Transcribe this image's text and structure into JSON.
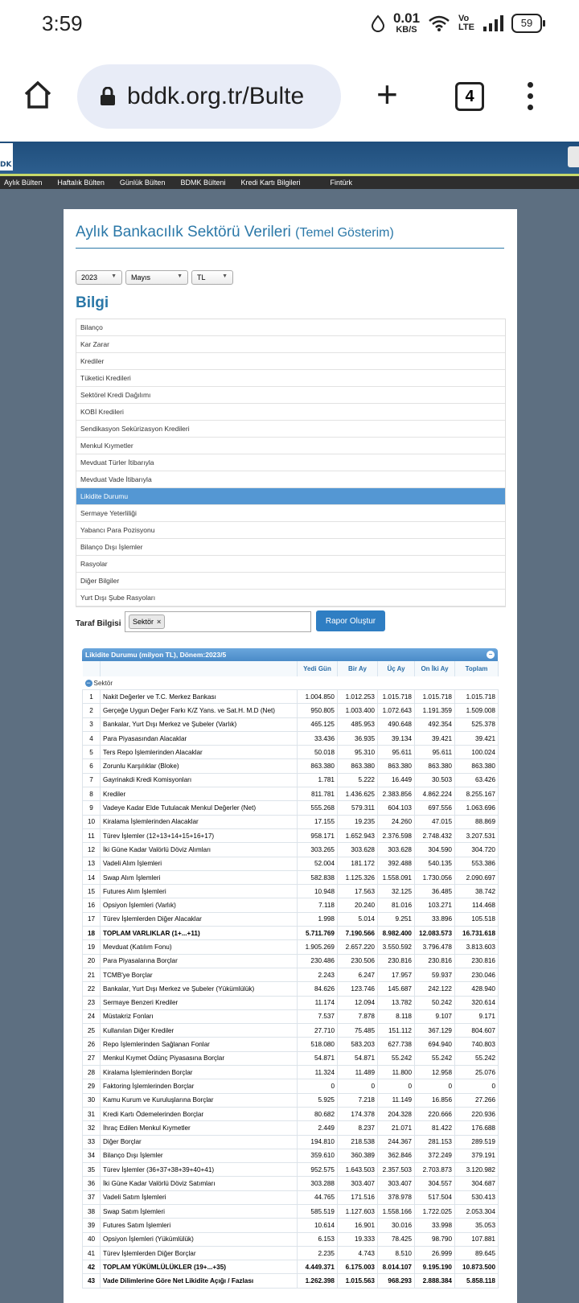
{
  "status_bar": {
    "time": "3:59",
    "net_speed": "0.01",
    "net_unit": "KB/S",
    "volte_top": "Vo",
    "volte_bottom": "LTE",
    "battery": "59"
  },
  "browser": {
    "url": "bddk.org.tr/Bulte",
    "tab_count": "4",
    "plus": "+"
  },
  "site": {
    "logo_text": "DK",
    "nav": [
      "Aylık Bülten",
      "Haftalık Bülten",
      "Günlük Bülten",
      "BDMK Bülteni",
      "Kredi Kartı Bilgileri",
      "Fintürk"
    ],
    "page_title": "Aylık Bankacılık Sektörü Verileri",
    "page_subtitle": "(Temel Gösterim)",
    "selects": {
      "year": "2023",
      "month": "Mayıs",
      "currency": "TL"
    },
    "section_title": "Bilgi",
    "menu": [
      "Bilanço",
      "Kar Zarar",
      "Krediler",
      "Tüketici Kredileri",
      "Sektörel Kredi Dağılımı",
      "KOBİ Kredileri",
      "Sendikasyon Sekürizasyon Kredileri",
      "Menkul Kıymetler",
      "Mevduat Türler İtibarıyla",
      "Mevduat Vade İtibarıyla",
      "Likidite Durumu",
      "Sermaye Yeterliliği",
      "Yabancı Para Pozisyonu",
      "Bilanço Dışı İşlemler",
      "Rasyolar",
      "Diğer Bilgiler",
      "Yurt Dışı Şube Rasyoları"
    ],
    "menu_active_index": 10,
    "taraf_label": "Taraf Bilgisi",
    "tag": "Sektör",
    "tag_remove": "×",
    "report_button": "Rapor Oluştur",
    "table": {
      "title": "Likidite Durumu (milyon TL), Dönem:2023/5",
      "collapse_icon": "−",
      "columns": [
        "Yedi Gün",
        "Bir Ay",
        "Üç Ay",
        "On İki Ay",
        "Toplam"
      ],
      "group": "Sektör",
      "rows": [
        {
          "no": "1",
          "name": "Nakit Değerler ve T.C. Merkez Bankası",
          "v": [
            "1.004.850",
            "1.012.253",
            "1.015.718",
            "1.015.718",
            "1.015.718"
          ]
        },
        {
          "no": "2",
          "name": "Gerçeğe Uygun Değer Farkı K/Z Yans. ve Sat.H. M.D (Net)",
          "v": [
            "950.805",
            "1.003.400",
            "1.072.643",
            "1.191.359",
            "1.509.008"
          ]
        },
        {
          "no": "3",
          "name": "Bankalar, Yurt Dışı Merkez ve Şubeler (Varlık)",
          "v": [
            "465.125",
            "485.953",
            "490.648",
            "492.354",
            "525.378"
          ]
        },
        {
          "no": "4",
          "name": "Para Piyasasından Alacaklar",
          "v": [
            "33.436",
            "36.935",
            "39.134",
            "39.421",
            "39.421"
          ]
        },
        {
          "no": "5",
          "name": "Ters Repo İşlemlerinden Alacaklar",
          "v": [
            "50.018",
            "95.310",
            "95.611",
            "95.611",
            "100.024"
          ]
        },
        {
          "no": "6",
          "name": "Zorunlu Karşılıklar (Bloke)",
          "v": [
            "863.380",
            "863.380",
            "863.380",
            "863.380",
            "863.380"
          ]
        },
        {
          "no": "7",
          "name": "Gayrinakdi Kredi Komisyonları",
          "v": [
            "1.781",
            "5.222",
            "16.449",
            "30.503",
            "63.426"
          ]
        },
        {
          "no": "8",
          "name": "Krediler",
          "v": [
            "811.781",
            "1.436.625",
            "2.383.856",
            "4.862.224",
            "8.255.167"
          ]
        },
        {
          "no": "9",
          "name": "Vadeye Kadar Elde Tutulacak Menkul Değerler (Net)",
          "v": [
            "555.268",
            "579.311",
            "604.103",
            "697.556",
            "1.063.696"
          ]
        },
        {
          "no": "10",
          "name": "Kiralama İşlemlerinden Alacaklar",
          "v": [
            "17.155",
            "19.235",
            "24.260",
            "47.015",
            "88.869"
          ]
        },
        {
          "no": "11",
          "name": "Türev İşlemler (12+13+14+15+16+17)",
          "v": [
            "958.171",
            "1.652.943",
            "2.376.598",
            "2.748.432",
            "3.207.531"
          ]
        },
        {
          "no": "12",
          "name": "İki Güne Kadar Valörlü Döviz Alımları",
          "v": [
            "303.265",
            "303.628",
            "303.628",
            "304.590",
            "304.720"
          ]
        },
        {
          "no": "13",
          "name": "Vadeli Alım İşlemleri",
          "v": [
            "52.004",
            "181.172",
            "392.488",
            "540.135",
            "553.386"
          ]
        },
        {
          "no": "14",
          "name": "Swap Alım İşlemleri",
          "v": [
            "582.838",
            "1.125.326",
            "1.558.091",
            "1.730.056",
            "2.090.697"
          ]
        },
        {
          "no": "15",
          "name": "Futures Alım İşlemleri",
          "v": [
            "10.948",
            "17.563",
            "32.125",
            "36.485",
            "38.742"
          ]
        },
        {
          "no": "16",
          "name": "Opsiyon İşlemleri (Varlık)",
          "v": [
            "7.118",
            "20.240",
            "81.016",
            "103.271",
            "114.468"
          ]
        },
        {
          "no": "17",
          "name": "Türev İşlemlerden Diğer Alacaklar",
          "v": [
            "1.998",
            "5.014",
            "9.251",
            "33.896",
            "105.518"
          ]
        },
        {
          "no": "18",
          "name": "TOPLAM VARLIKLAR (1+...+11)",
          "v": [
            "5.711.769",
            "7.190.566",
            "8.982.400",
            "12.083.573",
            "16.731.618"
          ],
          "bold": true
        },
        {
          "no": "19",
          "name": "Mevduat (Katılım Fonu)",
          "v": [
            "1.905.269",
            "2.657.220",
            "3.550.592",
            "3.796.478",
            "3.813.603"
          ]
        },
        {
          "no": "20",
          "name": "Para Piyasalarına Borçlar",
          "v": [
            "230.486",
            "230.506",
            "230.816",
            "230.816",
            "230.816"
          ]
        },
        {
          "no": "21",
          "name": "TCMB'ye Borçlar",
          "v": [
            "2.243",
            "6.247",
            "17.957",
            "59.937",
            "230.046"
          ]
        },
        {
          "no": "22",
          "name": "Bankalar, Yurt Dışı Merkez ve Şubeler (Yükümlülük)",
          "v": [
            "84.626",
            "123.746",
            "145.687",
            "242.122",
            "428.940"
          ]
        },
        {
          "no": "23",
          "name": "Sermaye Benzeri Krediler",
          "v": [
            "11.174",
            "12.094",
            "13.782",
            "50.242",
            "320.614"
          ]
        },
        {
          "no": "24",
          "name": "Müstakriz Fonları",
          "v": [
            "7.537",
            "7.878",
            "8.118",
            "9.107",
            "9.171"
          ]
        },
        {
          "no": "25",
          "name": "Kullanılan Diğer Krediler",
          "v": [
            "27.710",
            "75.485",
            "151.112",
            "367.129",
            "804.607"
          ]
        },
        {
          "no": "26",
          "name": "Repo İşlemlerinden Sağlanan Fonlar",
          "v": [
            "518.080",
            "583.203",
            "627.738",
            "694.940",
            "740.803"
          ]
        },
        {
          "no": "27",
          "name": "Menkul Kıymet Ödünç Piyasasına Borçlar",
          "v": [
            "54.871",
            "54.871",
            "55.242",
            "55.242",
            "55.242"
          ]
        },
        {
          "no": "28",
          "name": "Kiralama İşlemlerinden Borçlar",
          "v": [
            "11.324",
            "11.489",
            "11.800",
            "12.958",
            "25.076"
          ]
        },
        {
          "no": "29",
          "name": "Faktoring İşlemlerinden Borçlar",
          "v": [
            "0",
            "0",
            "0",
            "0",
            "0"
          ]
        },
        {
          "no": "30",
          "name": "Kamu Kurum ve Kuruluşlarına Borçlar",
          "v": [
            "5.925",
            "7.218",
            "11.149",
            "16.856",
            "27.266"
          ]
        },
        {
          "no": "31",
          "name": "Kredi Kartı Ödemelerinden Borçlar",
          "v": [
            "80.682",
            "174.378",
            "204.328",
            "220.666",
            "220.936"
          ]
        },
        {
          "no": "32",
          "name": "İhraç Edilen Menkul Kıymetler",
          "v": [
            "2.449",
            "8.237",
            "21.071",
            "81.422",
            "176.688"
          ]
        },
        {
          "no": "33",
          "name": "Diğer Borçlar",
          "v": [
            "194.810",
            "218.538",
            "244.367",
            "281.153",
            "289.519"
          ]
        },
        {
          "no": "34",
          "name": "Bilanço Dışı İşlemler",
          "v": [
            "359.610",
            "360.389",
            "362.846",
            "372.249",
            "379.191"
          ]
        },
        {
          "no": "35",
          "name": "Türev İşlemler (36+37+38+39+40+41)",
          "v": [
            "952.575",
            "1.643.503",
            "2.357.503",
            "2.703.873",
            "3.120.982"
          ]
        },
        {
          "no": "36",
          "name": "İki Güne Kadar Valörlü Döviz Satımları",
          "v": [
            "303.288",
            "303.407",
            "303.407",
            "304.557",
            "304.687"
          ]
        },
        {
          "no": "37",
          "name": "Vadeli Satım İşlemleri",
          "v": [
            "44.765",
            "171.516",
            "378.978",
            "517.504",
            "530.413"
          ]
        },
        {
          "no": "38",
          "name": "Swap Satım İşlemleri",
          "v": [
            "585.519",
            "1.127.603",
            "1.558.166",
            "1.722.025",
            "2.053.304"
          ]
        },
        {
          "no": "39",
          "name": "Futures Satım İşlemleri",
          "v": [
            "10.614",
            "16.901",
            "30.016",
            "33.998",
            "35.053"
          ]
        },
        {
          "no": "40",
          "name": "Opsiyon İşlemleri (Yükümlülük)",
          "v": [
            "6.153",
            "19.333",
            "78.425",
            "98.790",
            "107.881"
          ]
        },
        {
          "no": "41",
          "name": "Türev İşlemlerden Diğer Borçlar",
          "v": [
            "2.235",
            "4.743",
            "8.510",
            "26.999",
            "89.645"
          ]
        },
        {
          "no": "42",
          "name": "TOPLAM YÜKÜMLÜLÜKLER (19+...+35)",
          "v": [
            "4.449.371",
            "6.175.003",
            "8.014.107",
            "9.195.190",
            "10.873.500"
          ],
          "bold": true
        },
        {
          "no": "43",
          "name": "Vade Dilimlerine Göre Net Likidite Açığı / Fazlası",
          "v": [
            "1.262.398",
            "1.015.563",
            "968.293",
            "2.888.384",
            "5.858.118"
          ],
          "bold": true
        }
      ]
    }
  }
}
